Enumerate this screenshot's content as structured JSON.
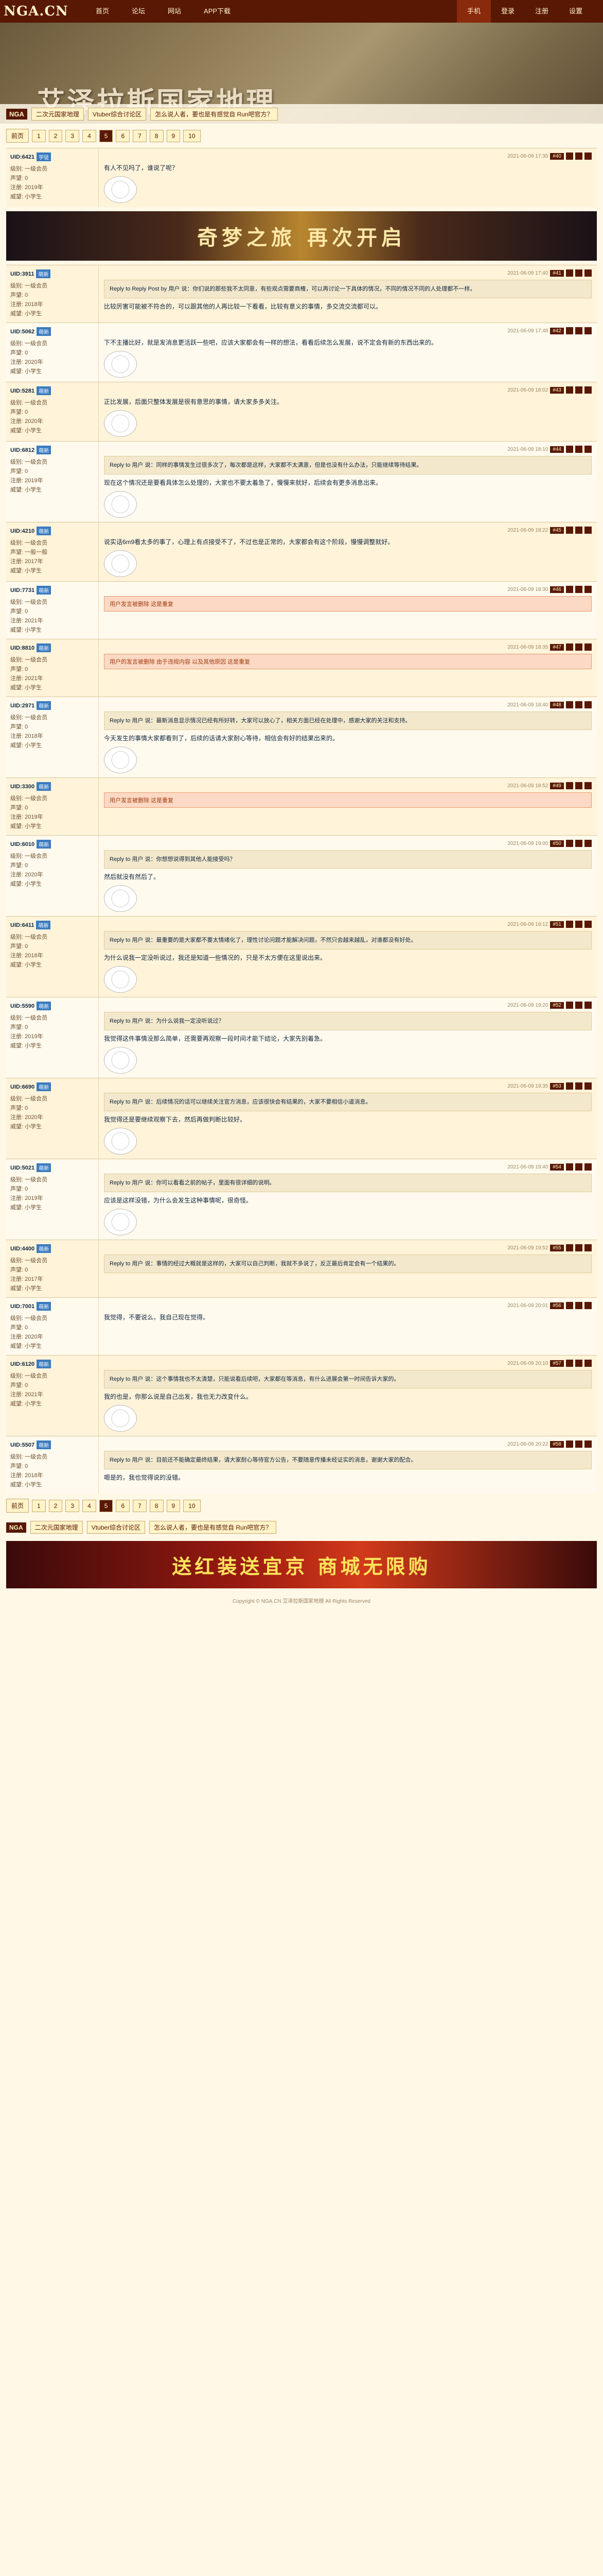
{
  "site": {
    "logo": "NGA.CN",
    "nav": [
      "首页",
      "论坛",
      "网站",
      "APP下载"
    ],
    "nav_right": [
      "手机",
      "登录",
      "注册",
      "设置"
    ]
  },
  "hero": {
    "title": "艾泽拉斯国家地理",
    "tag": "NGA",
    "crumbs": [
      "二次元国家地理",
      "Vtuber综合讨论区",
      "怎么说人者，要也是有感觉自 Run吧官方？"
    ]
  },
  "pager": [
    "前页",
    "1",
    "2",
    "3",
    "4",
    "5",
    "6",
    "7",
    "8",
    "9",
    "10"
  ],
  "pager_current": "5",
  "banner_top": "奇梦之旅 再次开启",
  "banner_bottom": "送红装送宜京 商城无限购",
  "posts": [
    {
      "uid": "UID:6421",
      "badge": "学徒",
      "meta": [
        "级别: 一级会员",
        "声望: 0",
        "注册: 2019年",
        "威望: 小学生"
      ],
      "floor": "#40",
      "time": "2021-06-09 17:35",
      "body": "有人不见吗了，谁说了呢？",
      "quote": "",
      "warn": "",
      "emoji": true
    },
    {
      "uid": "UID:3911",
      "badge": "萌新",
      "meta": [
        "级别: 一级会员",
        "声望: 0",
        "注册: 2018年",
        "威望: 小学生"
      ],
      "floor": "#41",
      "time": "2021-06-09 17:40",
      "body": "比较厉害可能被不符合的，可以跟其他的人再比较一下看看，比较有意义的事情，多交流交流都可以。",
      "quote": "Reply to Reply Post by 用户 说：你们说的那些我不太同意，有些观点需要商榷，可以再讨论一下具体的情况，不同的情况不同的人处理都不一样。",
      "warn": "",
      "emoji": false
    },
    {
      "uid": "UID:5062",
      "badge": "萌新",
      "meta": [
        "级别: 一级会员",
        "声望: 0",
        "注册: 2020年",
        "威望: 小学生"
      ],
      "floor": "#42",
      "time": "2021-06-09 17:48",
      "body": "下不主播比好，就是发消息更活跃一些吧，应该大家都会有一样的想法，看看后续怎么发展，说不定会有新的东西出来的。",
      "quote": "",
      "warn": "",
      "emoji": true
    },
    {
      "uid": "UID:5281",
      "badge": "萌新",
      "meta": [
        "级别: 一级会员",
        "声望: 0",
        "注册: 2020年",
        "威望: 小学生"
      ],
      "floor": "#43",
      "time": "2021-06-09 18:02",
      "body": "正比发展，后面只整体发展是很有意思的事情，请大家多多关注。",
      "quote": "",
      "warn": "",
      "emoji": true
    },
    {
      "uid": "UID:6812",
      "badge": "萌新",
      "meta": [
        "级别: 一级会员",
        "声望: 0",
        "注册: 2019年",
        "威望: 小学生"
      ],
      "floor": "#44",
      "time": "2021-06-09 18:10",
      "body": "现在这个情况还是要看具体怎么处理的，大家也不要太着急了，慢慢来就好，后续会有更多消息出来。",
      "quote": "Reply to 用户 说：同样的事情发生过很多次了，每次都是这样，大家都不太满意，但是也没有什么办法，只能继续等待结果。",
      "warn": "",
      "emoji": true
    },
    {
      "uid": "UID:4210",
      "badge": "萌新",
      "meta": [
        "级别: 一级会员",
        "声望: 一般一般",
        "注册: 2017年",
        "威望: 小学生"
      ],
      "floor": "#45",
      "time": "2021-06-09 18:22",
      "body": "说实话6m9看太多的事了，心理上有点接受不了，不过也是正常的，大家都会有这个阶段，慢慢调整就好。",
      "quote": "",
      "warn": "",
      "emoji": true
    },
    {
      "uid": "UID:7731",
      "badge": "萌新",
      "meta": [
        "级别: 一级会员",
        "声望: 0",
        "注册: 2021年",
        "威望: 小学生"
      ],
      "floor": "#46",
      "time": "2021-06-09 18:30",
      "body": "",
      "quote": "",
      "warn": "用户发言被删除 这是重复",
      "emoji": false
    },
    {
      "uid": "UID:8810",
      "badge": "萌新",
      "meta": [
        "级别: 一级会员",
        "声望: 0",
        "注册: 2021年",
        "威望: 小学生"
      ],
      "floor": "#47",
      "time": "2021-06-09 18:35",
      "body": "",
      "quote": "",
      "warn": "用户的发言被删除 由于违规内容 以及其他原因 这是重复",
      "emoji": false
    },
    {
      "uid": "UID:2971",
      "badge": "萌新",
      "meta": [
        "级别: 一级会员",
        "声望: 0",
        "注册: 2018年",
        "威望: 小学生"
      ],
      "floor": "#48",
      "time": "2021-06-09 18:40",
      "body": "今天发生的事情大家都看到了，后续的话请大家耐心等待，相信会有好的结果出来的。",
      "quote": "Reply to 用户 说：最新消息显示情况已经有所好转，大家可以放心了，相关方面已经在处理中，感谢大家的关注和支持。",
      "warn": "",
      "emoji": true
    },
    {
      "uid": "UID:3300",
      "badge": "萌新",
      "meta": [
        "级别: 一级会员",
        "声望: 0",
        "注册: 2019年",
        "威望: 小学生"
      ],
      "floor": "#49",
      "time": "2021-06-09 18:52",
      "body": "",
      "quote": "",
      "warn": "用户发言被删除 这是重复",
      "emoji": false
    },
    {
      "uid": "UID:6010",
      "badge": "萌新",
      "meta": [
        "级别: 一级会员",
        "声望: 0",
        "注册: 2020年",
        "威望: 小学生"
      ],
      "floor": "#50",
      "time": "2021-06-09 19:00",
      "body": "然后就没有然后了。",
      "quote": "Reply to 用户 说：你想想说得到其他人能接受吗？",
      "warn": "",
      "emoji": true
    },
    {
      "uid": "UID:6411",
      "badge": "萌新",
      "meta": [
        "级别: 一级会员",
        "声望: 0",
        "注册: 2018年",
        "威望: 小学生"
      ],
      "floor": "#51",
      "time": "2021-06-09 19:12",
      "body": "为什么说我一定没听说过，我还是知道一些情况的，只是不太方便在这里说出来。",
      "quote": "Reply to 用户 说：最重要的是大家都不要太情绪化了，理性讨论问题才能解决问题，不然只会越来越乱，对谁都没有好处。",
      "warn": "",
      "emoji": true
    },
    {
      "uid": "UID:5590",
      "badge": "萌新",
      "meta": [
        "级别: 一级会员",
        "声望: 0",
        "注册: 2019年",
        "威望: 小学生"
      ],
      "floor": "#52",
      "time": "2021-06-09 19:20",
      "body": "我觉得这件事情没那么简单，还需要再观察一段时间才能下结论，大家先别着急。",
      "quote": "Reply to 用户 说：为什么说我一定没听说过？",
      "warn": "",
      "emoji": true
    },
    {
      "uid": "UID:6690",
      "badge": "萌新",
      "meta": [
        "级别: 一级会员",
        "声望: 0",
        "注册: 2020年",
        "威望: 小学生"
      ],
      "floor": "#53",
      "time": "2021-06-09 19:35",
      "body": "我觉得还是要继续观察下去，然后再做判断比较好。",
      "quote": "Reply to 用户 说：后续情况的话可以继续关注官方消息，应该很快会有结果的，大家不要相信小道消息。",
      "warn": "",
      "emoji": true
    },
    {
      "uid": "UID:5021",
      "badge": "萌新",
      "meta": [
        "级别: 一级会员",
        "声望: 0",
        "注册: 2019年",
        "威望: 小学生"
      ],
      "floor": "#54",
      "time": "2021-06-09 19:40",
      "body": "应该是这样没错，为什么会发生这种事情呢，很奇怪。",
      "quote": "Reply to 用户 说：你可以看看之前的帖子，里面有很详细的说明。",
      "warn": "",
      "emoji": true
    },
    {
      "uid": "UID:4400",
      "badge": "萌新",
      "meta": [
        "级别: 一级会员",
        "声望: 0",
        "注册: 2017年",
        "威望: 小学生"
      ],
      "floor": "#55",
      "time": "2021-06-09 19:52",
      "body": "",
      "quote": "Reply to 用户 说：事情的经过大概就是这样的，大家可以自己判断，我就不多说了，反正最后肯定会有一个结果的。",
      "warn": "",
      "emoji": false
    },
    {
      "uid": "UID:7001",
      "badge": "萌新",
      "meta": [
        "级别: 一级会员",
        "声望: 0",
        "注册: 2020年",
        "威望: 小学生"
      ],
      "floor": "#56",
      "time": "2021-06-09 20:01",
      "body": "我觉得，不要说么，我自己现在觉得。",
      "quote": "",
      "warn": "",
      "emoji": false
    },
    {
      "uid": "UID:6120",
      "badge": "萌新",
      "meta": [
        "级别: 一级会员",
        "声望: 0",
        "注册: 2021年",
        "威望: 小学生"
      ],
      "floor": "#57",
      "time": "2021-06-09 20:10",
      "body": "我的也是，你那么说是自己出发，我也无力改变什么。",
      "quote": "Reply to 用户 说：这个事情我也不太清楚，只能说看后续吧，大家都在等消息，有什么进展会第一时间告诉大家的。",
      "warn": "",
      "emoji": true
    },
    {
      "uid": "UID:5507",
      "badge": "萌新",
      "meta": [
        "级别: 一级会员",
        "声望: 0",
        "注册: 2018年",
        "威望: 小学生"
      ],
      "floor": "#58",
      "time": "2021-06-09 20:22",
      "body": "嗯是的，我也觉得说的没错。",
      "quote": "Reply to 用户 说：目前还不能确定最终结果，请大家耐心等待官方公告，不要随意传播未经证实的消息，谢谢大家的配合。",
      "warn": "",
      "emoji": false
    }
  ],
  "bottom_crumbs": [
    "二次元国家地理",
    "Vtuber综合讨论区",
    "怎么说人者，要也是有感觉自 Run吧官方？"
  ],
  "copyright": "Copyright © NGA.CN 艾泽拉斯国家地理 All Rights Reserved"
}
